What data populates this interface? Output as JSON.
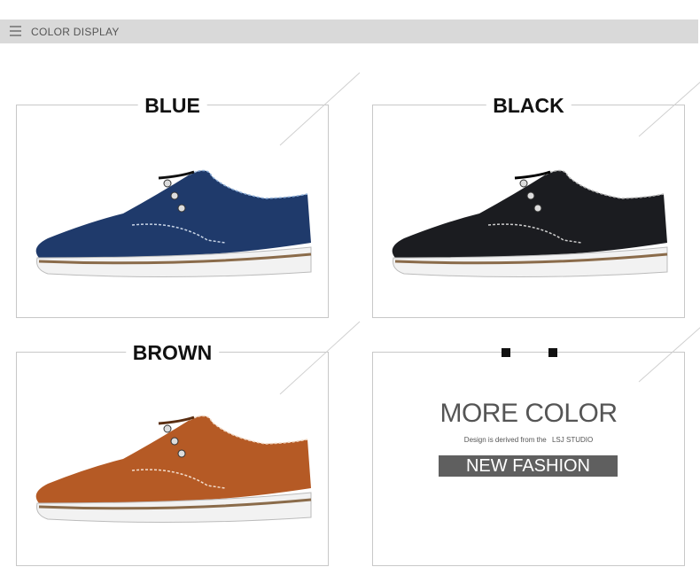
{
  "header": {
    "title": "COLOR DISPLAY",
    "icon": "menu-icon"
  },
  "products": [
    {
      "label": "BLUE",
      "color": "#1f3a6b"
    },
    {
      "label": "BLACK",
      "color": "#1b1c20"
    },
    {
      "label": "BROWN",
      "color": "#b55a25"
    }
  ],
  "promo": {
    "title": "MORE COLOR",
    "subtitle_pre": "Design is derived from the",
    "subtitle_brand": "LSJ STUDIO",
    "badge": "NEW FASHION"
  },
  "colors": {
    "header_bg": "#d9d9d9",
    "badge_bg": "#5f5f5f",
    "border": "#c8c8c8"
  }
}
